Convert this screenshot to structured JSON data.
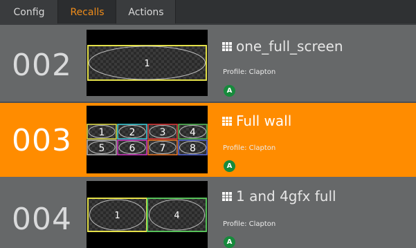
{
  "tabs": [
    {
      "label": "Config",
      "active": false
    },
    {
      "label": "Recalls",
      "active": true
    },
    {
      "label": "Actions",
      "active": false
    }
  ],
  "colors": {
    "accent_orange": "#ff8c00",
    "tab_active_text": "#f08d1a",
    "badge_green": "#178a3c"
  },
  "recalls": [
    {
      "number": "002",
      "name": "one_full_screen",
      "profile": "Profile: Clapton",
      "badge": "A",
      "active": false,
      "layout_icon": "grid-icon",
      "windows": [
        {
          "label": "1",
          "color": "#e5e24a"
        }
      ]
    },
    {
      "number": "003",
      "name": "Full wall",
      "profile": "Profile: Clapton",
      "badge": "A",
      "active": true,
      "layout_icon": "grid-icon",
      "windows": [
        {
          "label": "1",
          "color": "#e5e24a"
        },
        {
          "label": "2",
          "color": "#3fd4e0"
        },
        {
          "label": "3",
          "color": "#e23a3a"
        },
        {
          "label": "4",
          "color": "#58c25a"
        },
        {
          "label": "5",
          "color": "#b8b8b8"
        },
        {
          "label": "6",
          "color": "#d83ac8"
        },
        {
          "label": "7",
          "color": "#f07c2a"
        },
        {
          "label": "8",
          "color": "#5a6ee0"
        }
      ]
    },
    {
      "number": "004",
      "name": "1 and 4gfx full",
      "profile": "Profile: Clapton",
      "badge": "A",
      "active": false,
      "layout_icon": "grid-icon",
      "windows": [
        {
          "label": "1",
          "color": "#e5e24a"
        },
        {
          "label": "4",
          "color": "#58c25a"
        }
      ]
    }
  ]
}
